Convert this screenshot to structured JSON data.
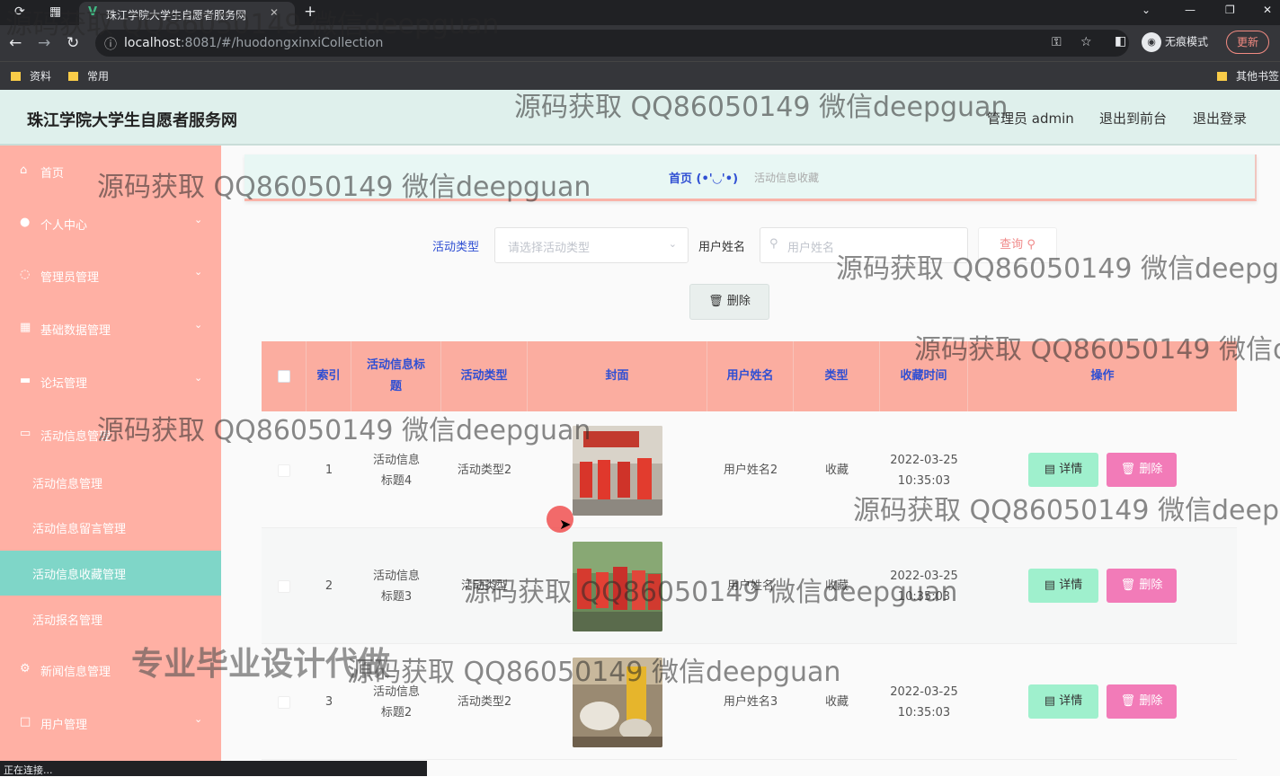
{
  "browser": {
    "tab_title": "珠江学院大学生自愿者服务网",
    "tab_icon": "V",
    "url_host": "localhost",
    "url_path": ":8081/#/huodongxinxiCollection",
    "incognito_label": "无痕模式",
    "update_label": "更新",
    "bookmarks": [
      "资料",
      "常用"
    ],
    "other_bookmarks": "其他书签",
    "status_text": "正在连接..."
  },
  "header": {
    "site_title": "珠江学院大学生自愿者服务网",
    "admin_label": "管理员 admin",
    "front_label": "退出到前台",
    "logout_label": "退出登录"
  },
  "sidebar": {
    "home": "首页",
    "personal": "个人中心",
    "admin_mgmt": "管理员管理",
    "base_data": "基础数据管理",
    "forum": "论坛管理",
    "activity": "活动信息管理",
    "sub_items": [
      "活动信息管理",
      "活动信息留言管理",
      "活动信息收藏管理",
      "活动报名管理"
    ],
    "news": "新闻信息管理",
    "users": "用户管理"
  },
  "breadcrumb": {
    "home": "首页",
    "face": "(•'◡'•)",
    "current": "活动信息收藏"
  },
  "filters": {
    "type_label": "活动类型",
    "type_placeholder": "请选择活动类型",
    "name_label": "用户姓名",
    "name_placeholder": "用户姓名",
    "query_label": "查询"
  },
  "toolbar": {
    "delete_label": "删除"
  },
  "table": {
    "headers": {
      "index": "索引",
      "title": "活动信息标题",
      "type": "活动类型",
      "cover": "封面",
      "user": "用户姓名",
      "kind": "类型",
      "time": "收藏时间",
      "ops": "操作"
    },
    "detail_label": "详情",
    "delete_label": "删除",
    "rows": [
      {
        "index": "1",
        "title": "活动信息标题4",
        "type": "活动类型2",
        "user": "用户姓名2",
        "kind": "收藏",
        "time": "2022-03-25 10:35:03"
      },
      {
        "index": "2",
        "title": "活动信息标题3",
        "type": "活动类型",
        "user": "用户姓名",
        "kind": "收藏",
        "time": "2022-03-25 10:35:03"
      },
      {
        "index": "3",
        "title": "活动信息标题2",
        "type": "活动类型2",
        "user": "用户姓名3",
        "kind": "收藏",
        "time": "2022-03-25 10:35:03"
      }
    ]
  },
  "watermarks": {
    "wm1": "源码获取 QQ86050149 微信deepguan",
    "wm_big": "专业毕业设计代做"
  },
  "colors": {
    "sidebar_bg": "#ffb0a4",
    "sidebar_active": "#7fd6c8",
    "header_bg": "#dff0ec",
    "table_head": "#fbada0",
    "detail_btn": "#9ff0cd",
    "delete_btn": "#f27bb8",
    "link_blue": "#2f4fd3"
  }
}
